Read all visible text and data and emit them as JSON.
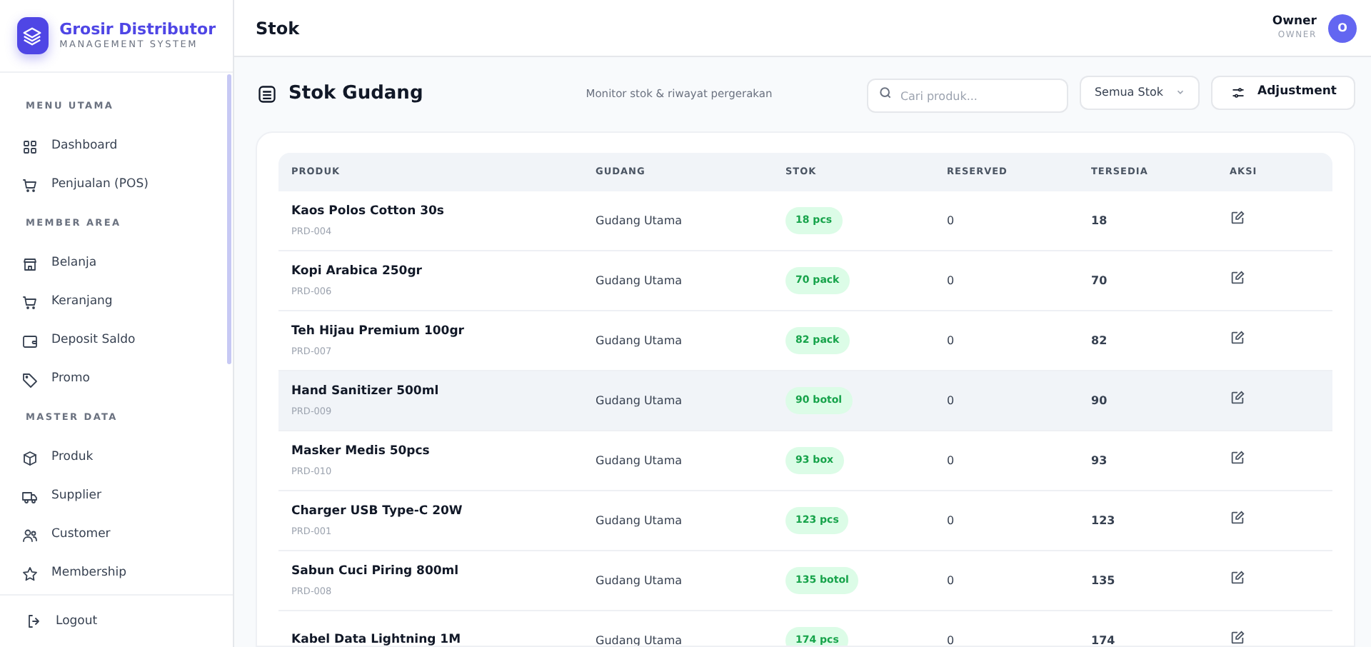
{
  "brand": {
    "title": "Grosir Distributor",
    "subtitle": "MANAGEMENT SYSTEM"
  },
  "sidebar": {
    "sections": [
      {
        "label": "MENU UTAMA",
        "items": [
          {
            "label": "Dashboard",
            "selected": false
          },
          {
            "label": "Penjualan (POS)",
            "selected": false
          }
        ]
      },
      {
        "label": "MEMBER AREA",
        "items": [
          {
            "label": "Belanja",
            "selected": false
          },
          {
            "label": "Keranjang",
            "selected": false
          },
          {
            "label": "Deposit Saldo",
            "selected": false
          },
          {
            "label": "Promo",
            "selected": false
          }
        ]
      },
      {
        "label": "MASTER DATA",
        "items": [
          {
            "label": "Produk",
            "selected": false
          },
          {
            "label": "Supplier",
            "selected": false
          },
          {
            "label": "Customer",
            "selected": false
          },
          {
            "label": "Membership",
            "selected": false
          }
        ]
      }
    ],
    "logout": "Logout"
  },
  "header": {
    "title": "Stok",
    "user_name": "Owner",
    "user_role": "OWNER",
    "avatar": "O"
  },
  "page": {
    "title": "Stok Gudang",
    "subtitle": "Monitor stok & riwayat pergerakan",
    "search": {
      "placeholder": "Cari produk..."
    },
    "filter": "Semua Stok",
    "action_button": "Adjustment"
  },
  "table": {
    "columns": [
      "PRODUK",
      "GUDANG",
      "STOK",
      "RESERVED",
      "TERSEDIA",
      "AKSI"
    ],
    "rows": [
      {
        "name": "Kaos Polos Cotton 30s",
        "sku": "PRD-004",
        "warehouse": "Gudang Utama",
        "stock": "18 pcs",
        "reserved": "0",
        "available": "18",
        "highlighted": false
      },
      {
        "name": "Kopi Arabica 250gr",
        "sku": "PRD-006",
        "warehouse": "Gudang Utama",
        "stock": "70 pack",
        "reserved": "0",
        "available": "70",
        "highlighted": false
      },
      {
        "name": "Teh Hijau Premium 100gr",
        "sku": "PRD-007",
        "warehouse": "Gudang Utama",
        "stock": "82 pack",
        "reserved": "0",
        "available": "82",
        "highlighted": false
      },
      {
        "name": "Hand Sanitizer 500ml",
        "sku": "PRD-009",
        "warehouse": "Gudang Utama",
        "stock": "90 botol",
        "reserved": "0",
        "available": "90",
        "highlighted": true
      },
      {
        "name": "Masker Medis 50pcs",
        "sku": "PRD-010",
        "warehouse": "Gudang Utama",
        "stock": "93 box",
        "reserved": "0",
        "available": "93",
        "highlighted": false
      },
      {
        "name": "Charger USB Type-C 20W",
        "sku": "PRD-001",
        "warehouse": "Gudang Utama",
        "stock": "123 pcs",
        "reserved": "0",
        "available": "123",
        "highlighted": false
      },
      {
        "name": "Sabun Cuci Piring 800ml",
        "sku": "PRD-008",
        "warehouse": "Gudang Utama",
        "stock": "135 botol",
        "reserved": "0",
        "available": "135",
        "highlighted": false
      },
      {
        "name": "Kabel Data Lightning 1M",
        "warehouse": "Gudang Utama",
        "stock": "174 pcs",
        "reserved": "0",
        "available": "174",
        "highlighted": false
      }
    ]
  }
}
